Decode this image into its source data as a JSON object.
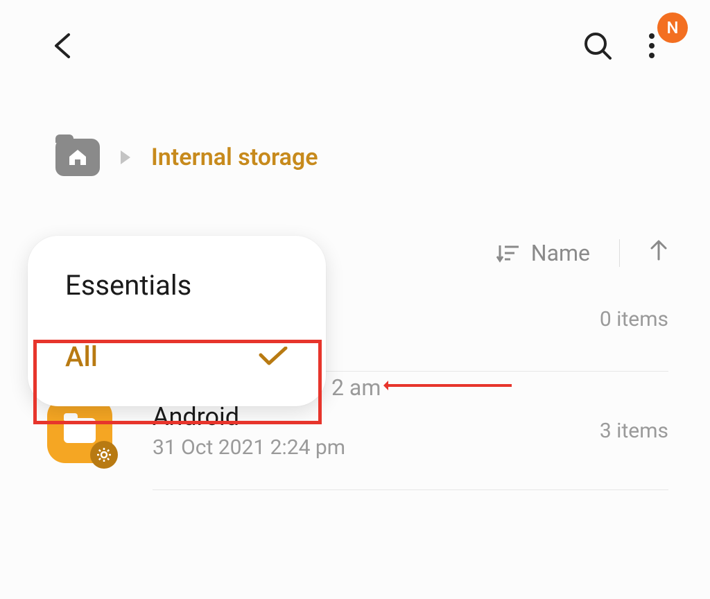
{
  "header": {
    "avatar_initial": "N"
  },
  "breadcrumb": {
    "current": "Internal storage"
  },
  "sort": {
    "label": "Name"
  },
  "popup": {
    "option_essentials": "Essentials",
    "option_all": "All"
  },
  "visible_row1_tail_time": "2 am",
  "rows": [
    {
      "title": "",
      "subtitle": "",
      "count": "0 items",
      "has_gear": false
    },
    {
      "title": "Android",
      "subtitle": "31 Oct 2021 2:24 pm",
      "count": "3 items",
      "has_gear": true
    }
  ]
}
